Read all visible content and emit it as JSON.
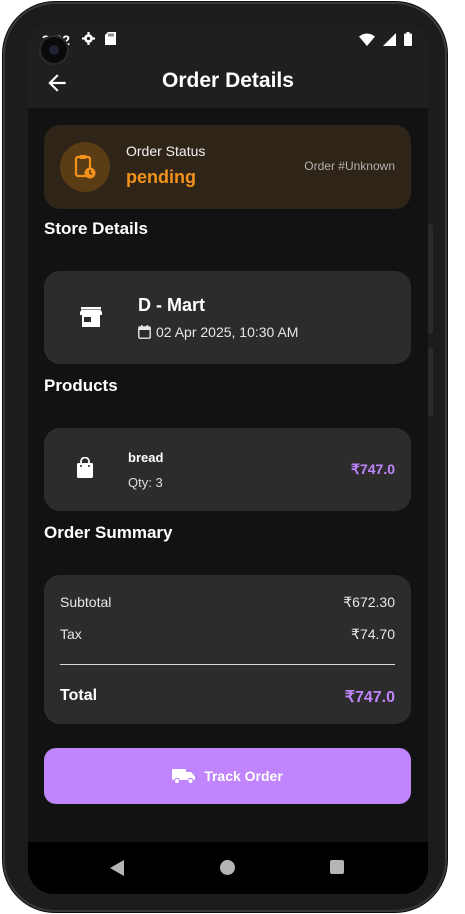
{
  "status_bar": {
    "time": "3:22"
  },
  "app_bar": {
    "title": "Order Details"
  },
  "order_status": {
    "label": "Order Status",
    "value": "pending",
    "order_number": "Order #Unknown",
    "accent_color": "#f3921a"
  },
  "store": {
    "section_title": "Store Details",
    "name": "D - Mart",
    "datetime": "02 Apr 2025, 10:30 AM"
  },
  "products": {
    "section_title": "Products",
    "items": [
      {
        "name": "bread",
        "qty": "Qty: 3",
        "price": "₹747.0"
      }
    ]
  },
  "summary": {
    "section_title": "Order Summary",
    "subtotal_label": "Subtotal",
    "subtotal_value": "₹672.30",
    "tax_label": "Tax",
    "tax_value": "₹74.70",
    "total_label": "Total",
    "total_value": "₹747.0"
  },
  "actions": {
    "track_label": "Track Order"
  },
  "theme": {
    "primary": "#c084fc",
    "background": "#121212",
    "card": "#2c2c2c"
  },
  "icons": [
    "back-arrow-icon",
    "clipboard-clock-icon",
    "store-icon",
    "calendar-icon",
    "shopping-bag-icon",
    "truck-icon",
    "settings-icon",
    "sd-card-icon",
    "wifi-icon",
    "signal-icon",
    "battery-icon"
  ]
}
